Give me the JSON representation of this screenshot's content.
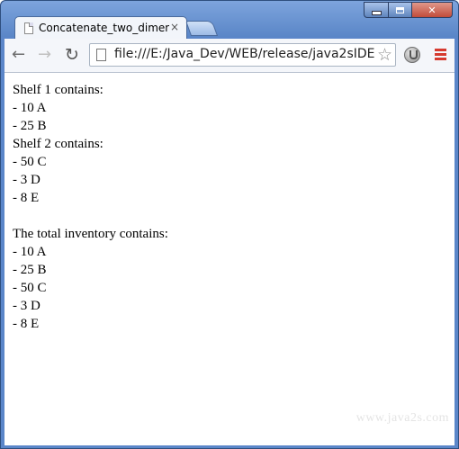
{
  "browser": {
    "tab_title": "Concatenate_two_dimens",
    "tab_close": "×",
    "url": "file:///E:/Java_Dev/WEB/release/java2sIDE",
    "icons": {
      "back": "back-arrow-icon",
      "forward": "forward-arrow-icon",
      "reload": "reload-icon",
      "star": "bookmark-star-icon",
      "extension": "extension-icon",
      "menu": "hamburger-menu-icon"
    },
    "colors": {
      "frame": "#5b86c9",
      "menu_accent": "#d63a2f"
    }
  },
  "page": {
    "lines": [
      "Shelf 1 contains:",
      "- 10 A",
      "- 25 B",
      "Shelf 2 contains:",
      "- 50 C",
      "- 3 D",
      "- 8 E",
      "",
      "The total inventory contains:",
      "- 10 A",
      "- 25 B",
      "- 50 C",
      "- 3 D",
      "- 8 E"
    ],
    "watermark": "www.java2s.com"
  }
}
